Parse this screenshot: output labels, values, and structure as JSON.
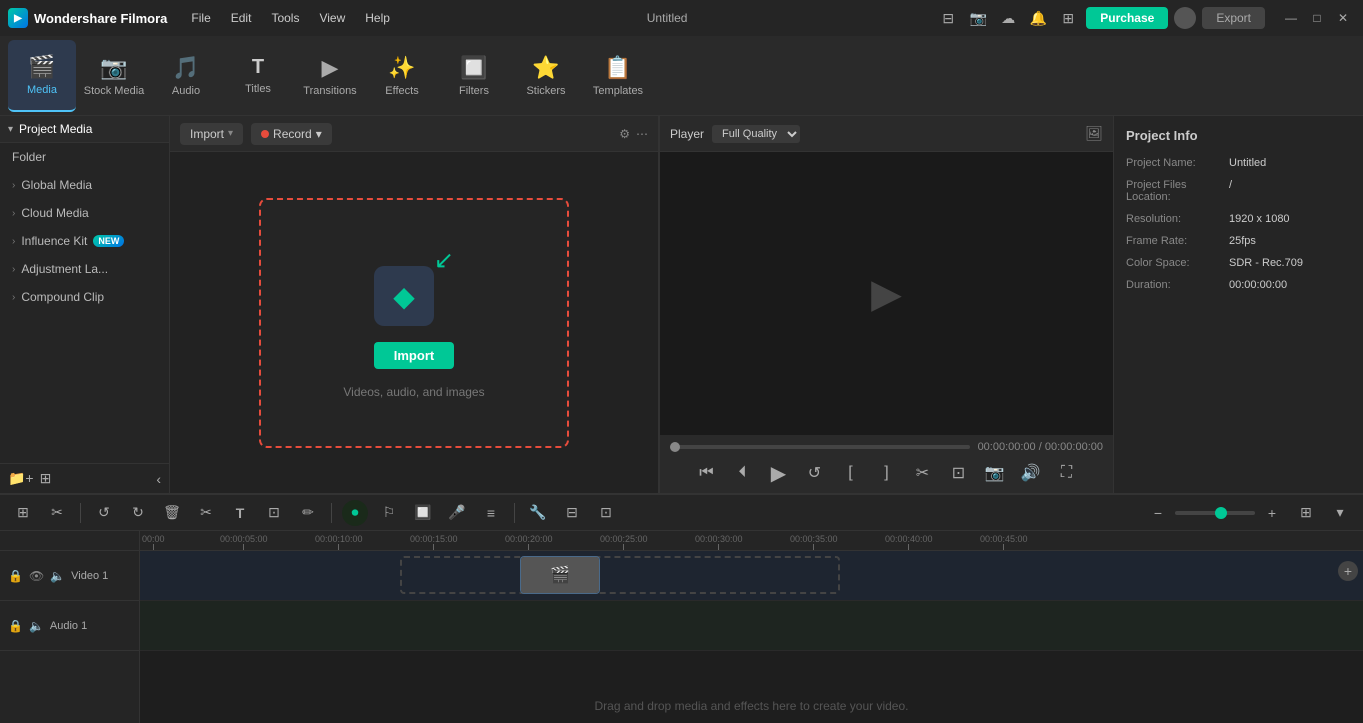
{
  "app": {
    "name": "Wondershare Filmora",
    "title": "Untitled"
  },
  "menu": {
    "items": [
      "File",
      "Edit",
      "Tools",
      "View",
      "Help"
    ]
  },
  "titlebar": {
    "purchase_label": "Purchase",
    "export_label": "Export"
  },
  "toolbar": {
    "items": [
      {
        "id": "media",
        "label": "Media",
        "icon": "🎬",
        "active": true
      },
      {
        "id": "stock-media",
        "label": "Stock Media",
        "icon": "📷"
      },
      {
        "id": "audio",
        "label": "Audio",
        "icon": "🎵"
      },
      {
        "id": "titles",
        "label": "Titles",
        "icon": "T"
      },
      {
        "id": "transitions",
        "label": "Transitions",
        "icon": "▶"
      },
      {
        "id": "effects",
        "label": "Effects",
        "icon": "✨"
      },
      {
        "id": "filters",
        "label": "Filters",
        "icon": "🔲"
      },
      {
        "id": "stickers",
        "label": "Stickers",
        "icon": "⭐"
      },
      {
        "id": "templates",
        "label": "Templates",
        "icon": "📋"
      }
    ]
  },
  "sidebar": {
    "header": "Project Media",
    "items": [
      {
        "label": "Folder"
      },
      {
        "label": "Global Media"
      },
      {
        "label": "Cloud Media"
      },
      {
        "label": "Influence Kit",
        "badge": "NEW"
      },
      {
        "label": "Adjustment La..."
      },
      {
        "label": "Compound Clip"
      }
    ]
  },
  "media_panel": {
    "import_label": "Import",
    "record_label": "Record",
    "import_desc": "Videos, audio, and images",
    "import_btn_label": "Import"
  },
  "player": {
    "label": "Player",
    "quality": "Full Quality",
    "time_current": "00:00:00:00",
    "time_total": "00:00:00:00"
  },
  "project_info": {
    "title": "Project Info",
    "name_label": "Project Name:",
    "name_value": "Untitled",
    "files_label": "Project Files Location:",
    "files_value": "/",
    "resolution_label": "Resolution:",
    "resolution_value": "1920 x 1080",
    "framerate_label": "Frame Rate:",
    "framerate_value": "25fps",
    "colorspace_label": "Color Space:",
    "colorspace_value": "SDR - Rec.709",
    "duration_label": "Duration:",
    "duration_value": "00:00:00:00"
  },
  "timeline": {
    "drag_drop_label": "Drag and drop media and effects here to create your video.",
    "tracks": [
      {
        "id": "video1",
        "label": "Video 1",
        "type": "video"
      },
      {
        "id": "audio1",
        "label": "Audio 1",
        "type": "audio"
      }
    ],
    "ruler_marks": [
      "00:00",
      "00:00:05:00",
      "00:00:10:00",
      "00:00:15:00",
      "00:00:20:00",
      "00:00:25:00",
      "00:00:30:00",
      "00:00:35:00",
      "00:00:40:00",
      "00:00:45:00"
    ]
  },
  "icons": {
    "chevron_right": "›",
    "chevron_down": "▾",
    "add": "+",
    "minus": "−",
    "undo": "↺",
    "redo": "↻",
    "delete": "🗑",
    "cut": "✂",
    "text": "T",
    "crop": "⊡",
    "draw": "✏",
    "filter_icon": "⚙",
    "dots": "⋯",
    "play": "▶",
    "pause": "⏸",
    "skip_back": "⏮",
    "skip_fwd": "⏭",
    "loop": "🔁",
    "crop2": "⊞",
    "fullscreen": "⛶",
    "snapshot": "📷",
    "volume": "🔊",
    "more": "⋯",
    "minimize": "—",
    "maximize": "□",
    "close": "✕",
    "picture": "🖼",
    "lock": "🔒",
    "eye": "👁",
    "speaker": "🔈",
    "mic": "🎤",
    "magnet": "🔧",
    "ripple": "≋",
    "grid": "⊞"
  }
}
